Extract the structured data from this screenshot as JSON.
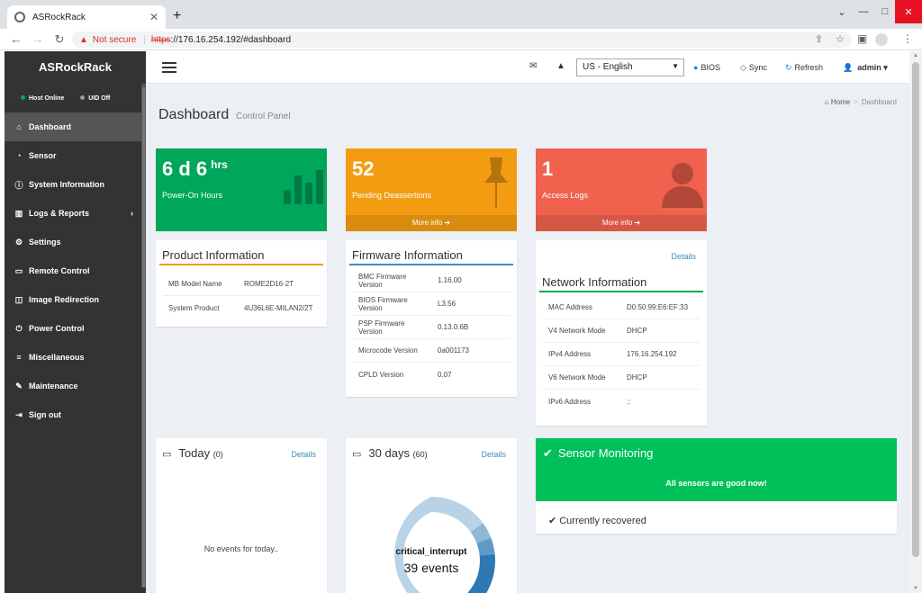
{
  "browser": {
    "tab_title": "ASRockRack",
    "tab_close": "✕",
    "new_tab": "+",
    "not_secure": "Not secure",
    "url_scheme": "https",
    "url_rest": "://176.16.254.192/#dashboard"
  },
  "sidebar": {
    "brand": "ASRockRack",
    "host_status": "Host Online",
    "uid_status": "UID Off",
    "items": [
      {
        "label": "Dashboard",
        "icon": "home-icon"
      },
      {
        "label": "Sensor",
        "icon": "dashboard-gauge-icon"
      },
      {
        "label": "System Information",
        "icon": "info-icon"
      },
      {
        "label": "Logs & Reports",
        "icon": "bar-chart-icon"
      },
      {
        "label": "Settings",
        "icon": "gear-icon"
      },
      {
        "label": "Remote Control",
        "icon": "monitor-icon"
      },
      {
        "label": "Image Redirection",
        "icon": "disk-icon"
      },
      {
        "label": "Power Control",
        "icon": "power-icon"
      },
      {
        "label": "Miscellaneous",
        "icon": "list-icon"
      },
      {
        "label": "Maintenance",
        "icon": "wrench-icon"
      },
      {
        "label": "Sign out",
        "icon": "sign-out-icon"
      }
    ]
  },
  "topnav": {
    "language": "US - English",
    "bios": "BIOS",
    "sync": "Sync",
    "refresh": "Refresh",
    "user": "admin"
  },
  "page": {
    "title": "Dashboard",
    "subtitle": "Control Panel",
    "breadcrumb_home": "Home",
    "breadcrumb_current": "Dashboard"
  },
  "stats": {
    "power": {
      "value": "6 d 6",
      "unit": "hrs",
      "label": "Power-On Hours",
      "color": "#00a65a"
    },
    "deassert": {
      "value": "52",
      "label": "Pending Deassertions",
      "more": "More info",
      "color": "#f39c12"
    },
    "access": {
      "value": "1",
      "label": "Access Logs",
      "more": "More info",
      "color": "#f0614e"
    }
  },
  "product": {
    "title": "Product Information",
    "rows": [
      {
        "k": "MB Model Name",
        "v": "ROME2D16-2T"
      },
      {
        "k": "System Product",
        "v": "4U36L6E-MILAN2/2T"
      }
    ]
  },
  "firmware": {
    "title": "Firmware Information",
    "rows": [
      {
        "k": "BMC Firmware Version",
        "v": "1.16.00"
      },
      {
        "k": "BIOS Firmware Version",
        "v": "L3.56"
      },
      {
        "k": "PSP Firmware Version",
        "v": "0.13.0.6B"
      },
      {
        "k": "Microcode Version",
        "v": "0a001173"
      },
      {
        "k": "CPLD Version",
        "v": "0.07"
      }
    ]
  },
  "network": {
    "details": "Details",
    "title": "Network Information",
    "rows": [
      {
        "k": "MAC Address",
        "v": "D0:50:99:E6:EF:33"
      },
      {
        "k": "V4 Network Mode",
        "v": "DHCP"
      },
      {
        "k": "IPv4 Address",
        "v": "176.16.254.192"
      },
      {
        "k": "V6 Network Mode",
        "v": "DHCP"
      },
      {
        "k": "IPv6 Address",
        "v": "::"
      }
    ]
  },
  "today": {
    "title": "Today",
    "count": "(0)",
    "details": "Details",
    "empty": "No events for today.."
  },
  "days30": {
    "title": "30 days",
    "count": "(60)",
    "details": "Details",
    "center_label": "critical_interrupt",
    "center_value": "39 events"
  },
  "sensor": {
    "title": "Sensor Monitoring",
    "message": "All sensors are good now!",
    "recovered": "Currently recovered"
  }
}
